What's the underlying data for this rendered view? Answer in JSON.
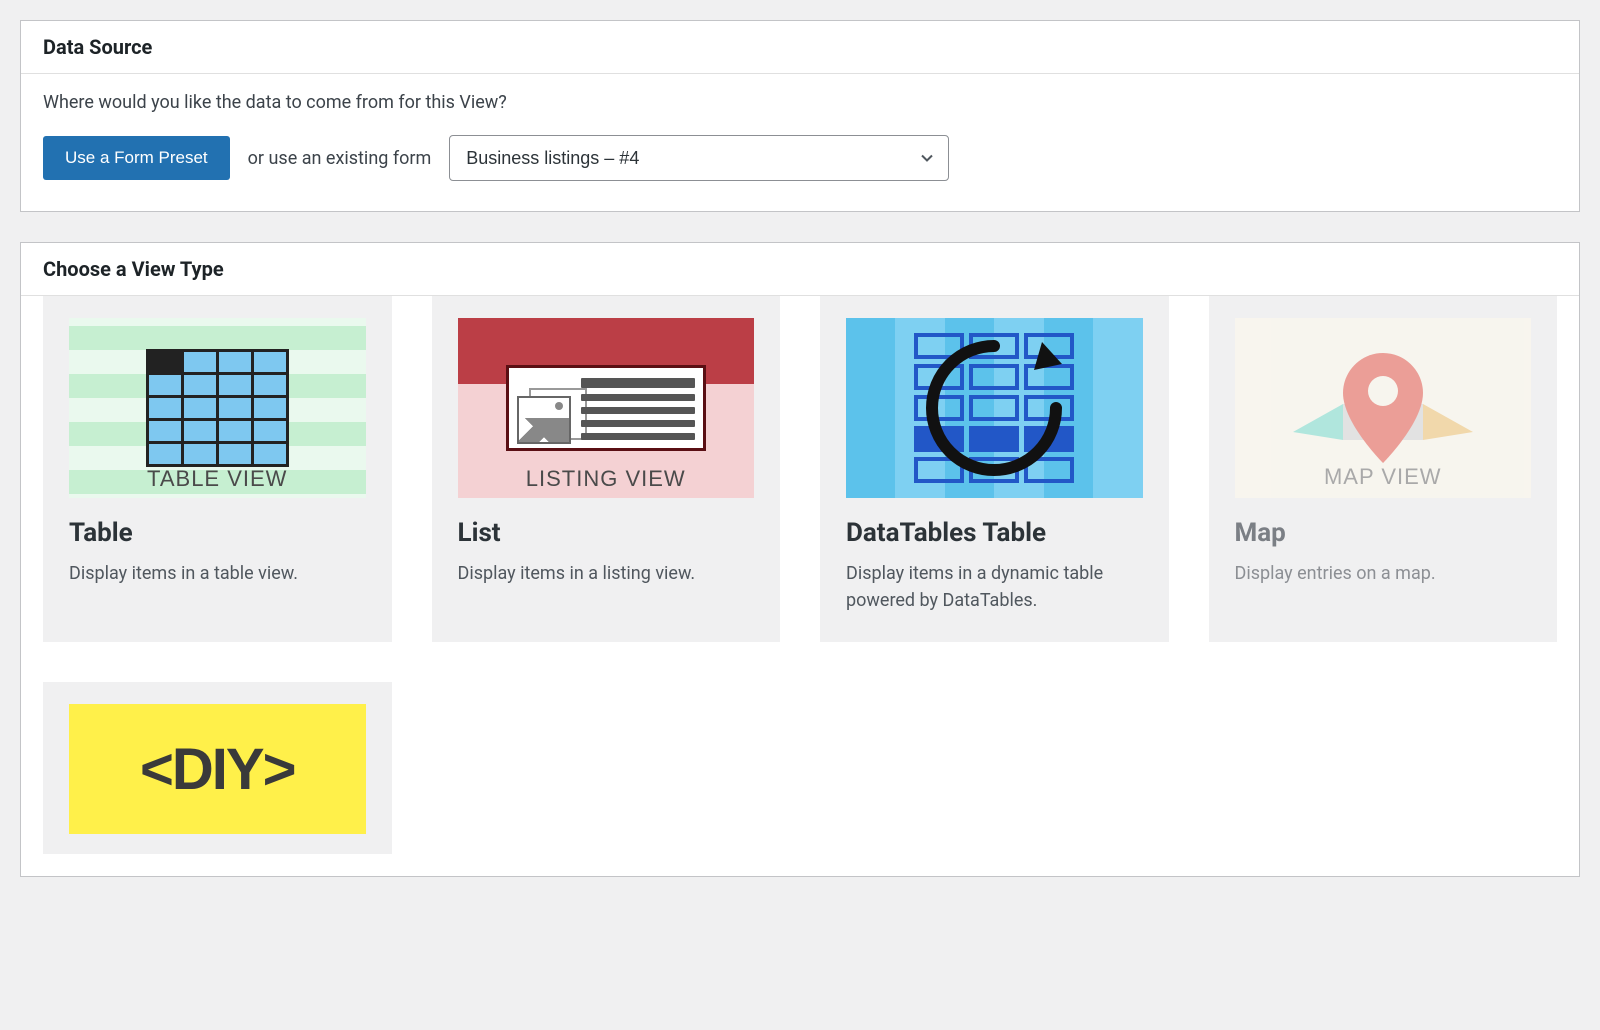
{
  "dataSource": {
    "heading": "Data Source",
    "prompt": "Where would you like the data to come from for this View?",
    "presetButton": "Use a Form Preset",
    "orText": "or use an existing form",
    "selectedForm": "Business listings – #4"
  },
  "viewTypeSection": {
    "heading": "Choose a View Type"
  },
  "viewTypes": [
    {
      "key": "table",
      "title": "Table",
      "description": "Display items in a table view.",
      "thumbLabel": "TABLE VIEW"
    },
    {
      "key": "list",
      "title": "List",
      "description": "Display items in a listing view.",
      "thumbLabel": "LISTING VIEW"
    },
    {
      "key": "datatables",
      "title": "DataTables Table",
      "description": "Display items in a dynamic table powered by DataTables."
    },
    {
      "key": "map",
      "title": "Map",
      "description": "Display entries on a map.",
      "thumbLabel": "MAP VIEW",
      "dim": true
    },
    {
      "key": "diy",
      "thumbLabel": "<DIY>"
    }
  ]
}
